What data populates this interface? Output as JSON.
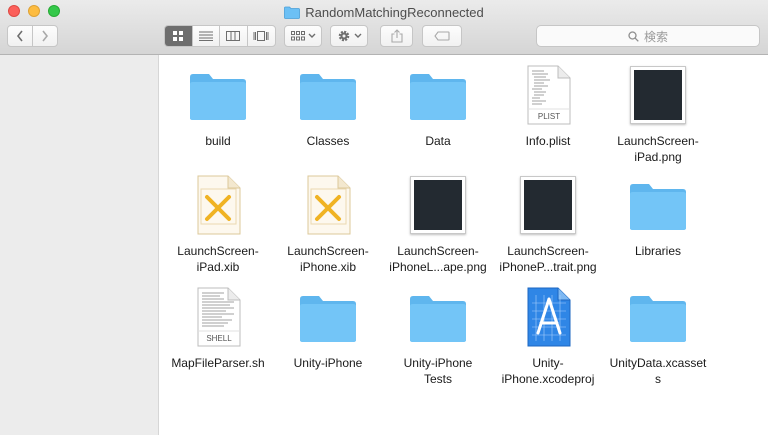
{
  "window": {
    "title": "RandomMatchingReconnected"
  },
  "toolbar": {
    "back_icon": "chevron-left-icon",
    "forward_icon": "chevron-right-icon",
    "view_modes": [
      "icon-view-icon",
      "list-view-icon",
      "column-view-icon",
      "coverflow-view-icon"
    ],
    "active_view": "icon-view-icon",
    "search_placeholder": "検索"
  },
  "colors": {
    "folder": "#6cc0f5",
    "thumbnail": "#232a31",
    "accent": "#2a8ce8"
  },
  "items": [
    {
      "label": "build",
      "kind": "folder"
    },
    {
      "label": "Classes",
      "kind": "folder"
    },
    {
      "label": "Data",
      "kind": "folder"
    },
    {
      "label": "Info.plist",
      "kind": "document",
      "badge": "PLIST"
    },
    {
      "label": "LaunchScreen-\niPad.png",
      "kind": "image"
    },
    {
      "label": "LaunchScreen-\niPad.xib",
      "kind": "xib"
    },
    {
      "label": "LaunchScreen-\niPhone.xib",
      "kind": "xib"
    },
    {
      "label": "LaunchScreen-\niPhoneL...ape.png",
      "kind": "image"
    },
    {
      "label": "LaunchScreen-\niPhoneP...trait.png",
      "kind": "image"
    },
    {
      "label": "Libraries",
      "kind": "folder"
    },
    {
      "label": "MapFileParser.sh",
      "kind": "document",
      "badge": "SHELL"
    },
    {
      "label": "Unity-iPhone",
      "kind": "folder"
    },
    {
      "label": "Unity-iPhone\nTests",
      "kind": "folder"
    },
    {
      "label": "Unity-\niPhone.xcodeproj",
      "kind": "xcodeproj"
    },
    {
      "label": "UnityData.xcasset\ns",
      "kind": "folder"
    }
  ]
}
